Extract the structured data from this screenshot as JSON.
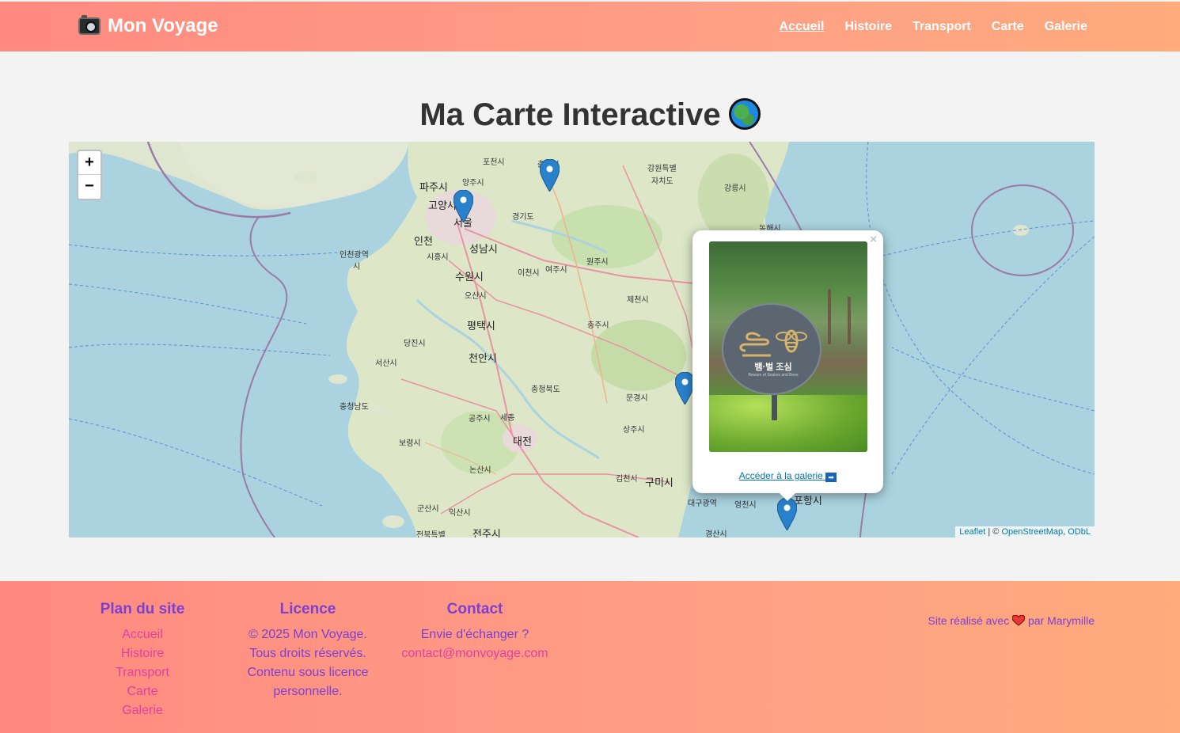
{
  "header": {
    "brand": "Mon Voyage",
    "brand_icon": "camera-icon",
    "nav": [
      {
        "label": "Accueil",
        "active": true
      },
      {
        "label": "Histoire",
        "active": false
      },
      {
        "label": "Transport",
        "active": false
      },
      {
        "label": "Carte",
        "active": false
      },
      {
        "label": "Galerie",
        "active": false
      }
    ]
  },
  "main": {
    "title": "Ma Carte Interactive",
    "title_icon": "globe-icon"
  },
  "map": {
    "zoom_in": "+",
    "zoom_out": "−",
    "attribution": {
      "leaflet": "Leaflet",
      "sep": " | © ",
      "osm": "OpenStreetMap",
      "comma": ", ",
      "odbl": "ODbL"
    },
    "cities": [
      {
        "name": "춘천시",
        "big": false
      },
      {
        "name": "파주시",
        "big": true
      },
      {
        "name": "양주시",
        "big": false
      },
      {
        "name": "포천시",
        "big": false
      },
      {
        "name": "강원특별",
        "big": false
      },
      {
        "name": "자치도",
        "big": false
      },
      {
        "name": "강릉시",
        "big": false
      },
      {
        "name": "고양시",
        "big": true
      },
      {
        "name": "서울",
        "big": true
      },
      {
        "name": "경기도",
        "big": false
      },
      {
        "name": "인천",
        "big": true
      },
      {
        "name": "성남시",
        "big": true
      },
      {
        "name": "시흥시",
        "big": false
      },
      {
        "name": "인천광역",
        "big": false
      },
      {
        "name": "시",
        "big": false
      },
      {
        "name": "동해시",
        "big": false
      },
      {
        "name": "이천시",
        "big": false
      },
      {
        "name": "여주시",
        "big": false
      },
      {
        "name": "원주시",
        "big": false
      },
      {
        "name": "수원시",
        "big": true
      },
      {
        "name": "오산시",
        "big": false
      },
      {
        "name": "제천시",
        "big": false
      },
      {
        "name": "평택시",
        "big": true
      },
      {
        "name": "충주시",
        "big": false
      },
      {
        "name": "당진시",
        "big": false
      },
      {
        "name": "서산시",
        "big": false
      },
      {
        "name": "천안시",
        "big": true
      },
      {
        "name": "충청북도",
        "big": false
      },
      {
        "name": "문경시",
        "big": false
      },
      {
        "name": "충청남도",
        "big": false
      },
      {
        "name": "공주시",
        "big": false
      },
      {
        "name": "세종",
        "big": false
      },
      {
        "name": "대전",
        "big": true
      },
      {
        "name": "상주시",
        "big": false
      },
      {
        "name": "보령시",
        "big": false
      },
      {
        "name": "논산시",
        "big": false
      },
      {
        "name": "김천시",
        "big": false
      },
      {
        "name": "구미시",
        "big": true
      },
      {
        "name": "군산시",
        "big": false
      },
      {
        "name": "익산시",
        "big": false
      },
      {
        "name": "대구광역",
        "big": false
      },
      {
        "name": "영천시",
        "big": false
      },
      {
        "name": "포항시",
        "big": true
      },
      {
        "name": "전북특별",
        "big": false
      },
      {
        "name": "전주시",
        "big": true
      },
      {
        "name": "경산시",
        "big": false
      }
    ],
    "markers": [
      "map-marker-icon",
      "map-marker-icon",
      "map-marker-icon",
      "map-marker-icon"
    ],
    "popup": {
      "close": "×",
      "sign_title": "뱀·벌 조심",
      "sign_sub": "Beware of Snakes and Bees",
      "link": "Accéder à la galerie",
      "link_icon": "arrow-right-icon",
      "link_arrow": "➡"
    }
  },
  "footer": {
    "plan": {
      "title": "Plan du site",
      "links": [
        "Accueil",
        "Histoire",
        "Transport",
        "Carte",
        "Galerie"
      ]
    },
    "licence": {
      "title": "Licence",
      "lines": [
        "© 2025 Mon Voyage.",
        "Tous droits réservés.",
        "Contenu sous licence",
        "personnelle."
      ]
    },
    "contact": {
      "title": "Contact",
      "text": "Envie d'échanger ?",
      "email": "contact@monvoyage.com"
    },
    "made": {
      "before": "Site réalisé avec",
      "after": "par Marymille",
      "icon": "heart-icon"
    }
  }
}
